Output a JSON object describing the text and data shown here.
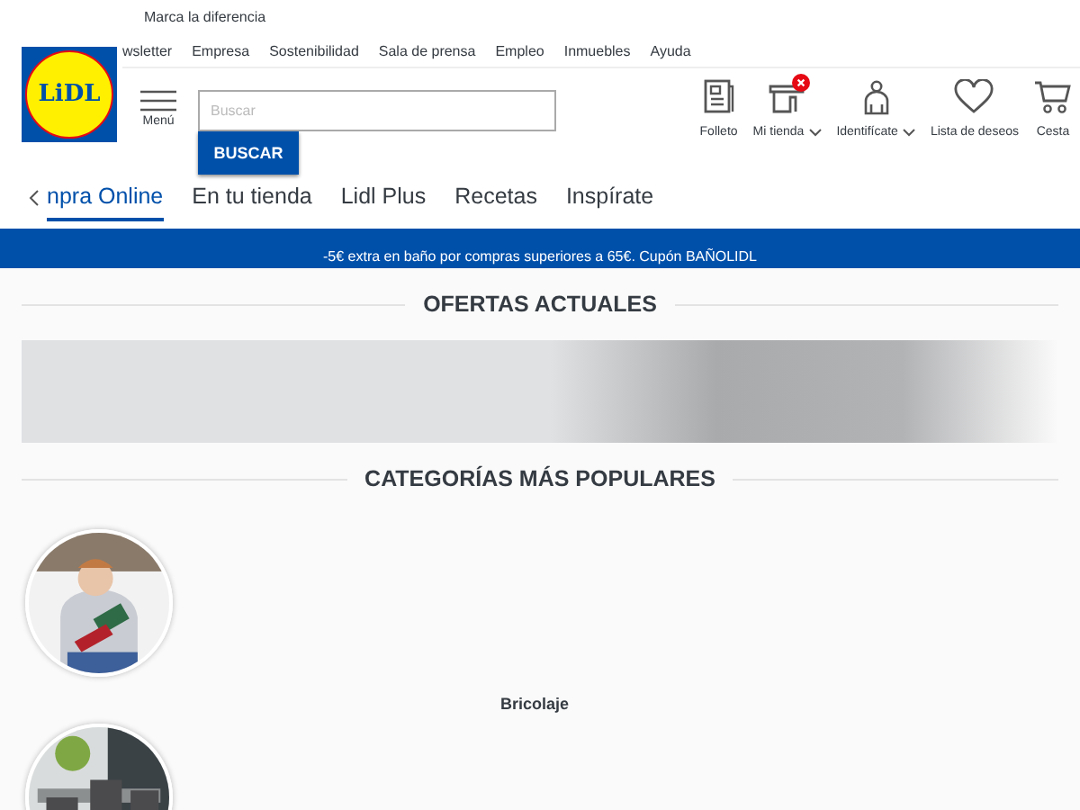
{
  "tagline": "Marca la diferencia",
  "top_links": [
    "wsletter",
    "Empresa",
    "Sostenibilidad",
    "Sala de prensa",
    "Empleo",
    "Inmuebles",
    "Ayuda"
  ],
  "logo": {
    "text": "LiDL"
  },
  "menu": {
    "label": "Menú"
  },
  "search": {
    "placeholder": "Buscar",
    "button": "BUSCAR"
  },
  "header_actions": [
    {
      "kind": "flyer",
      "label": "Folleto",
      "dropdown": false,
      "badge": false
    },
    {
      "kind": "store",
      "label": "Mi tienda",
      "dropdown": true,
      "badge": true
    },
    {
      "kind": "account",
      "label": "Identifícate",
      "dropdown": true,
      "badge": false
    },
    {
      "kind": "wishlist",
      "label": "Lista de deseos",
      "dropdown": false,
      "badge": false
    },
    {
      "kind": "cart",
      "label": "Cesta",
      "dropdown": false,
      "badge": false
    }
  ],
  "nav_tabs": [
    {
      "label": "npra Online",
      "selected": true
    },
    {
      "label": "En tu tienda",
      "selected": false
    },
    {
      "label": "Lidl Plus",
      "selected": false
    },
    {
      "label": "Recetas",
      "selected": false
    },
    {
      "label": "Inspírate",
      "selected": false
    }
  ],
  "promo": "-5€ extra en baño por compras superiores a 65€. Cupón BAÑOLIDL",
  "offers": {
    "title": "OFERTAS ACTUALES"
  },
  "categories_section": {
    "title": "CATEGORÍAS MÁS POPULARES"
  },
  "categories": [
    {
      "kind": "picture",
      "label": "Bricolaje"
    },
    {
      "kind": "picture"
    }
  ]
}
